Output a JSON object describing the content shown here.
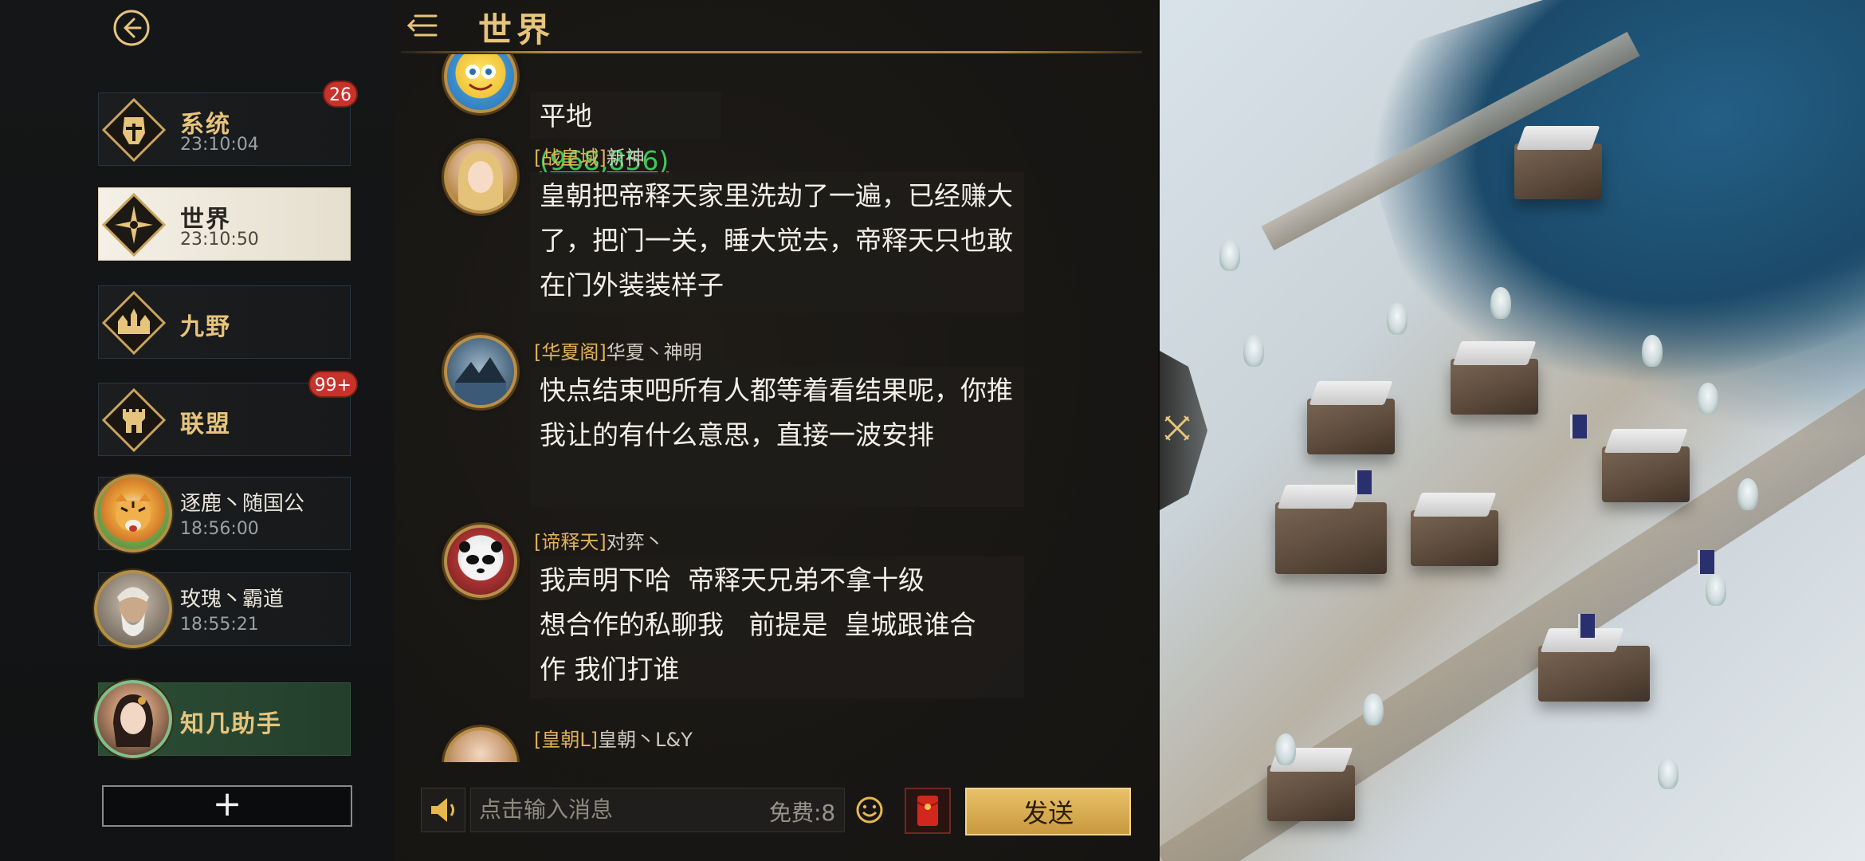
{
  "header": {
    "title": "世界"
  },
  "sidebar": {
    "channels": [
      {
        "name": "系统",
        "time": "23:10:04",
        "badge": "26",
        "icon": "helmet-emblem-icon"
      },
      {
        "name": "世界",
        "time": "23:10:50",
        "icon": "compass-emblem-icon",
        "active": true
      },
      {
        "name": "九野",
        "icon": "castle-emblem-icon"
      },
      {
        "name": "联盟",
        "badge": "99+",
        "icon": "tower-emblem-icon"
      },
      {
        "name": "逐鹿丶随国公",
        "time": "18:56:00"
      },
      {
        "name": "玫瑰丶霸道",
        "time": "18:55:21"
      },
      {
        "name": "知几助手"
      }
    ],
    "add_label": "+"
  },
  "messages": [
    {
      "sender_tag": "",
      "sender_name": "",
      "text": "平地",
      "coord": "(968,856)"
    },
    {
      "sender_tag": "[战皇城]",
      "sender_name": "新神",
      "text": "皇朝把帝释天家里洗劫了一遍，已经赚大了，把门一关，睡大觉去，帝释天只也敢在门外装装样子"
    },
    {
      "sender_tag": "[华夏阁]",
      "sender_name": "华夏丶神明",
      "text": "快点结束吧所有人都等着看结果呢，你推我让的有什么意思，直接一波安排"
    },
    {
      "sender_tag": "[谛释天]",
      "sender_name": "对弈丶",
      "text_lines": [
        "我声明下哈  帝释天兄弟不拿十级",
        "想合作的私聊我   前提是  皇城跟谁合",
        "作 我们打谁"
      ]
    },
    {
      "sender_tag": "[皇朝L]",
      "sender_name": "皇朝丶L&Y"
    }
  ],
  "input": {
    "placeholder": "点击输入消息",
    "free_label": "免费:8",
    "send_label": "发送"
  },
  "colors": {
    "accent_gold": "#e6c47c",
    "badge_red": "#c7332a",
    "coord_green": "#3fc85a",
    "send_button": "#d9ad52"
  }
}
